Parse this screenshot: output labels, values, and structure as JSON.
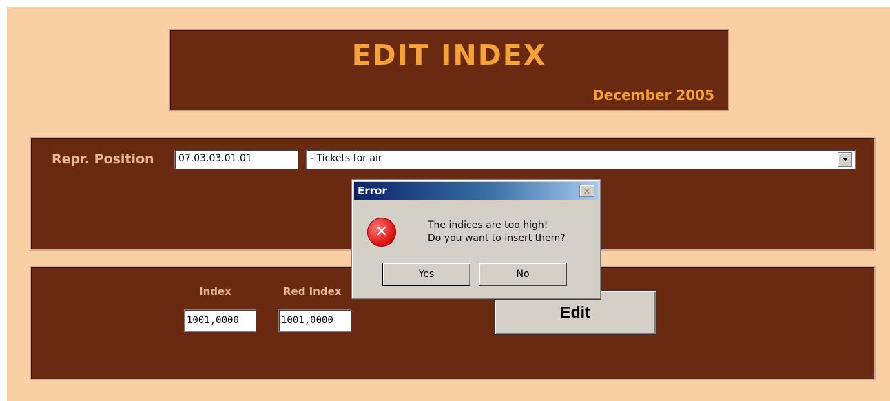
{
  "header": {
    "title": "EDIT INDEX",
    "date": "December 2005"
  },
  "position": {
    "label": "Repr. Position",
    "code": "07.03.03.01.01",
    "description": "- Tickets for air"
  },
  "indices": {
    "index_label": "Index",
    "red_index_label": "Red Index",
    "index_value": "1001,0000",
    "red_index_value": "1001,0000",
    "edit_label": "Edit"
  },
  "dialog": {
    "title": "Error",
    "close_glyph": "✕",
    "icon_glyph": "✕",
    "message_line1": "The indices are too high!",
    "message_line2": "Do you want to insert them?",
    "yes_label": "Yes",
    "no_label": "No"
  },
  "colors": {
    "background": "#f9cfa3",
    "panel": "#6a2a12",
    "accent": "#f5a237"
  },
  "icons": {
    "dropdown": "chevron-down-icon",
    "error": "error-icon",
    "close": "close-icon"
  }
}
